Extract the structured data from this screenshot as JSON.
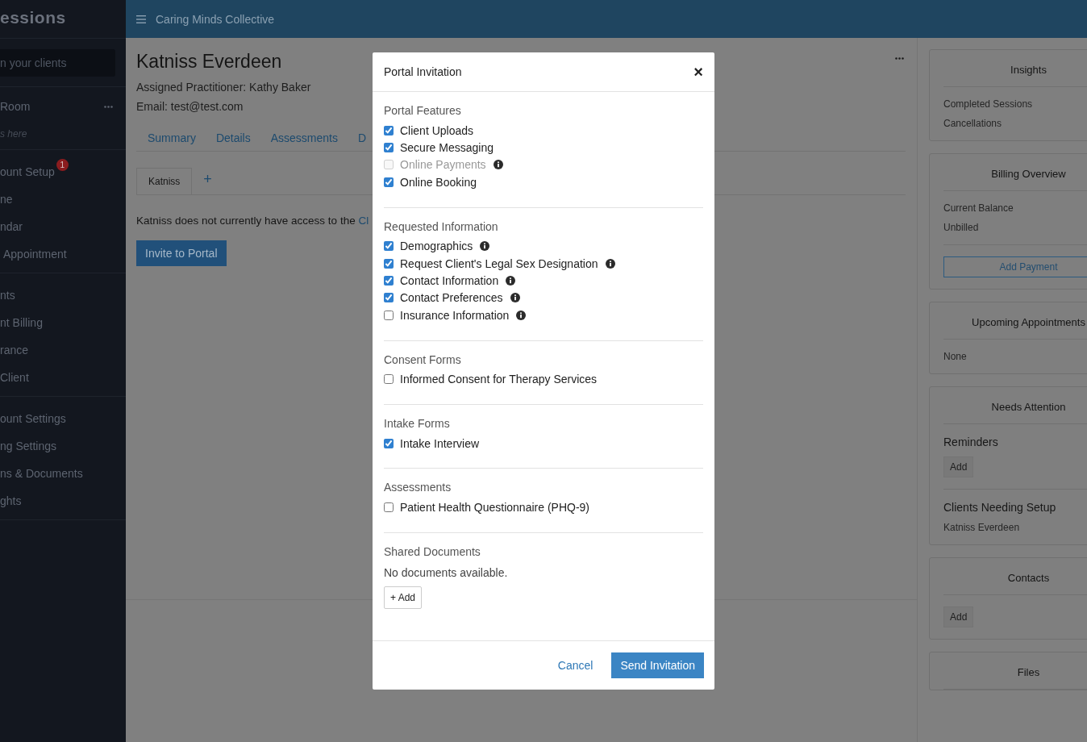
{
  "sidebar": {
    "title": "essions",
    "search": {
      "placeholder": "n your clients"
    },
    "room": {
      "label": "Room",
      "hint": "s here"
    },
    "groups": [
      {
        "items": [
          {
            "label": "ount Setup",
            "badge": "1"
          },
          {
            "label": "ne"
          },
          {
            "label": "ndar"
          },
          {
            "label": "Appointment"
          }
        ]
      },
      {
        "items": [
          {
            "label": "nts"
          },
          {
            "label": "nt Billing"
          },
          {
            "label": "rance"
          },
          {
            "label": "Client"
          }
        ]
      },
      {
        "items": [
          {
            "label": "ount Settings"
          },
          {
            "label": "ng Settings"
          },
          {
            "label": "ns & Documents"
          },
          {
            "label": "ghts"
          }
        ]
      }
    ]
  },
  "topbar": {
    "title": "Caring Minds Collective"
  },
  "client": {
    "name": "Katniss Everdeen",
    "practitioner_label": "Assigned Practitioner:",
    "practitioner": "Kathy Baker",
    "email_label": "Email:",
    "email": "test@test.com"
  },
  "tabs": [
    "Summary",
    "Details",
    "Assessments",
    "D"
  ],
  "subtabs": [
    {
      "label": "Katniss",
      "selected": true
    }
  ],
  "add_subtab": "+",
  "notice": {
    "text": "Katniss does not currently have access to the ",
    "link": "Cl"
  },
  "invite_button": "Invite to Portal",
  "right_cards": [
    {
      "title": "Insights",
      "sections": [
        {
          "items": [
            {
              "kind": "text",
              "text": "Completed Sessions"
            },
            {
              "kind": "text",
              "text": "Cancellations"
            }
          ]
        }
      ]
    },
    {
      "title": "Billing Overview",
      "sections": [
        {
          "items": [
            {
              "kind": "text",
              "text": "Current Balance"
            },
            {
              "kind": "text",
              "text": "Unbilled"
            }
          ]
        },
        {
          "items": [
            {
              "kind": "outline_button",
              "text": "Add Payment"
            }
          ]
        }
      ]
    },
    {
      "title": "Upcoming Appointments",
      "sections": [
        {
          "items": [
            {
              "kind": "text",
              "text": "None"
            }
          ]
        }
      ]
    },
    {
      "title": "Needs Attention",
      "sections": [
        {
          "items": [
            {
              "kind": "heading",
              "text": "Reminders"
            },
            {
              "kind": "button",
              "text": "Add"
            }
          ]
        },
        {
          "items": [
            {
              "kind": "heading",
              "text": "Clients Needing Setup"
            },
            {
              "kind": "text",
              "text": "Katniss Everdeen"
            }
          ]
        }
      ]
    },
    {
      "title": "Contacts",
      "sections": [
        {
          "items": [
            {
              "kind": "button",
              "text": "Add"
            }
          ]
        }
      ]
    },
    {
      "title": "Files"
    }
  ],
  "modal": {
    "title": "Portal Invitation",
    "close": "×",
    "sections": [
      {
        "title": "Portal Features",
        "kind": "checks",
        "options": [
          {
            "label": "Client Uploads",
            "checked": true,
            "disabled": false,
            "info": false
          },
          {
            "label": "Secure Messaging",
            "checked": true,
            "disabled": false,
            "info": false
          },
          {
            "label": "Online Payments",
            "checked": false,
            "disabled": true,
            "info": true
          },
          {
            "label": "Online Booking",
            "checked": true,
            "disabled": false,
            "info": false
          }
        ]
      },
      {
        "title": "Requested Information",
        "kind": "checks",
        "options": [
          {
            "label": "Demographics",
            "checked": true,
            "disabled": false,
            "info": true
          },
          {
            "label": "Request Client's Legal Sex Designation",
            "checked": true,
            "disabled": false,
            "info": true
          },
          {
            "label": "Contact Information",
            "checked": true,
            "disabled": false,
            "info": true
          },
          {
            "label": "Contact Preferences",
            "checked": true,
            "disabled": false,
            "info": true
          },
          {
            "label": "Insurance Information",
            "checked": false,
            "disabled": false,
            "info": true
          }
        ]
      },
      {
        "title": "Consent Forms",
        "kind": "checks",
        "options": [
          {
            "label": "Informed Consent for Therapy Services",
            "checked": false,
            "disabled": false,
            "info": false
          }
        ]
      },
      {
        "title": "Intake Forms",
        "kind": "checks",
        "options": [
          {
            "label": "Intake Interview",
            "checked": true,
            "disabled": false,
            "info": false
          }
        ]
      },
      {
        "title": "Assessments",
        "kind": "checks",
        "options": [
          {
            "label": "Patient Health Questionnaire (PHQ-9)",
            "checked": false,
            "disabled": false,
            "info": false
          }
        ]
      },
      {
        "title": "Shared Documents",
        "kind": "documents",
        "empty": "No documents available.",
        "add_button": "+ Add"
      }
    ],
    "cancel": "Cancel",
    "submit": "Send Invitation"
  }
}
